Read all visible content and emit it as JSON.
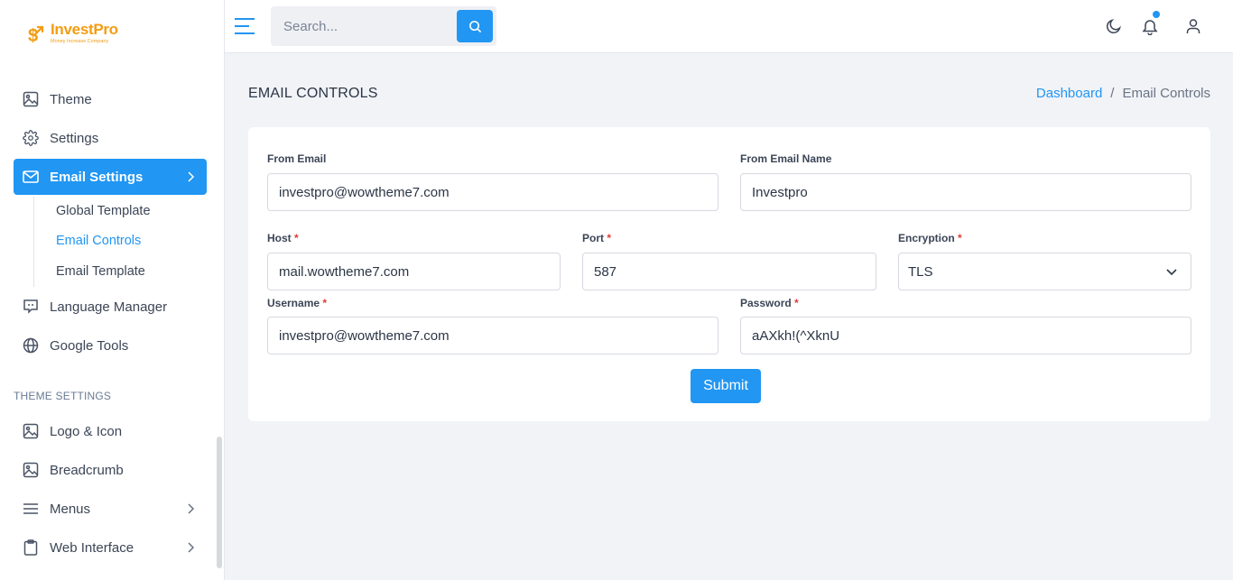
{
  "brand": {
    "name": "InvestPro",
    "tagline": "Money Increase Company",
    "color": "#f39c12"
  },
  "accent": "#2196f3",
  "sidebar": {
    "items": [
      {
        "label": "Theme",
        "icon": "image-icon"
      },
      {
        "label": "Settings",
        "icon": "gear-icon"
      },
      {
        "label": "Email Settings",
        "icon": "mail-icon",
        "active": true
      },
      {
        "label": "Language Manager",
        "icon": "chat-icon"
      },
      {
        "label": "Google Tools",
        "icon": "globe-icon"
      }
    ],
    "email_sub": [
      {
        "label": "Global Template"
      },
      {
        "label": "Email Controls",
        "active": true
      },
      {
        "label": "Email Template"
      }
    ],
    "section_label": "THEME SETTINGS",
    "theme_items": [
      {
        "label": "Logo & Icon",
        "icon": "image-icon"
      },
      {
        "label": "Breadcrumb",
        "icon": "image-icon"
      },
      {
        "label": "Menus",
        "icon": "menu-icon"
      },
      {
        "label": "Web Interface",
        "icon": "clipboard-icon"
      }
    ]
  },
  "header": {
    "search_placeholder": "Search..."
  },
  "page": {
    "title": "EMAIL CONTROLS",
    "breadcrumb": {
      "home": "Dashboard",
      "separator": "/",
      "current": "Email Controls"
    }
  },
  "form": {
    "from_email": {
      "label": "From Email",
      "value": "investpro@wowtheme7.com"
    },
    "from_email_name": {
      "label": "From Email Name",
      "value": "Investpro"
    },
    "host": {
      "label": "Host",
      "value": "mail.wowtheme7.com"
    },
    "port": {
      "label": "Port",
      "value": "587"
    },
    "encryption": {
      "label": "Encryption",
      "value": "TLS"
    },
    "username": {
      "label": "Username",
      "value": "investpro@wowtheme7.com"
    },
    "password": {
      "label": "Password",
      "value": "aAXkh!(^XknU"
    },
    "required_mark": "*",
    "submit_label": "Submit"
  }
}
